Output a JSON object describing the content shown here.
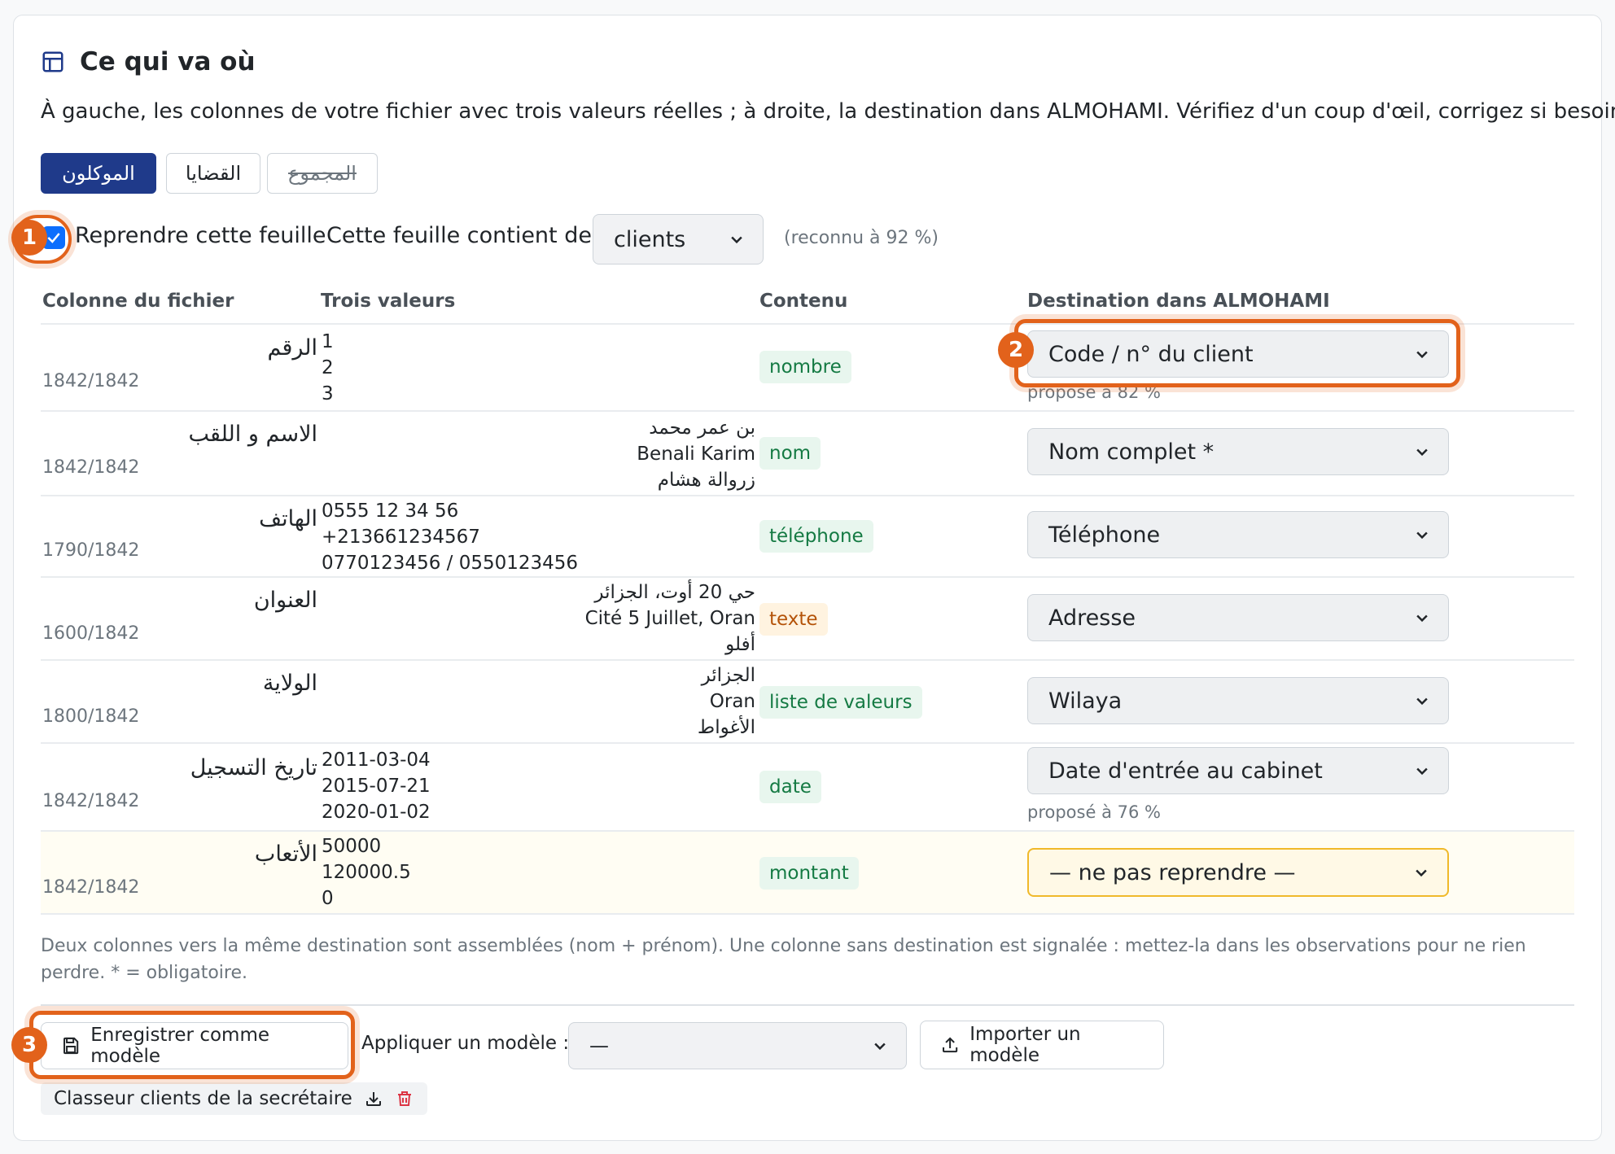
{
  "header": {
    "icon": "table-icon",
    "title": "Ce qui va où",
    "intro": "À gauche, les colonnes de votre fichier avec trois valeurs réelles ; à droite, la destination dans ALMOHAMI. Vérifiez d'un coup d'œil, corrigez si besoin."
  },
  "sheet_tabs": [
    {
      "label": "الموكلون",
      "active": true
    },
    {
      "label": "القضايا",
      "active": false
    },
    {
      "label": "المجموع",
      "active": false,
      "excluded": true
    }
  ],
  "sheet_options": {
    "take_sheet_label": "Reprendre cette feuille",
    "take_sheet_checked": true,
    "contains_label": "Cette feuille contient des",
    "contains_value": "clients",
    "recognized": "(reconnu à 92 %)"
  },
  "table": {
    "headers": [
      "Colonne du fichier",
      "Trois valeurs",
      "Contenu",
      "Destination dans ALMOHAMI"
    ],
    "rows": [
      {
        "column": "الرقم",
        "count": "1842/1842",
        "values": [
          "1",
          "2",
          "3"
        ],
        "content": "nombre",
        "destination": "Code / n° du client",
        "hint": "proposé à 82 %"
      },
      {
        "column": "الاسم و اللقب",
        "count": "1842/1842",
        "values": [
          "بن عمر محمد",
          "Benali Karim",
          "زروالة هشام"
        ],
        "content": "nom",
        "destination": "Nom complet *",
        "hint": ""
      },
      {
        "column": "الهاتف",
        "count": "1790/1842",
        "values": [
          "0555 12 34 56",
          "+213661234567",
          "0770123456 / 0550123456"
        ],
        "content": "téléphone",
        "destination": "Téléphone",
        "hint": ""
      },
      {
        "column": "العنوان",
        "count": "1600/1842",
        "values": [
          "حي 20 أوت، الجزائر",
          "Cité 5 Juillet, Oran",
          "أفلو"
        ],
        "content": "texte",
        "destination": "Adresse",
        "hint": ""
      },
      {
        "column": "الولاية",
        "count": "1800/1842",
        "values": [
          "الجزائر",
          "Oran",
          "الأغواط"
        ],
        "content": "liste de valeurs",
        "destination": "Wilaya",
        "hint": ""
      },
      {
        "column": "تاريخ التسجيل",
        "count": "1842/1842",
        "values": [
          "2011-03-04",
          "2015-07-21",
          "2020-01-02"
        ],
        "content": "date",
        "destination": "Date d'entrée au cabinet",
        "hint": "proposé à 76 %"
      },
      {
        "column": "الأتعاب",
        "count": "1842/1842",
        "values": [
          "50000",
          "120000.5",
          "0"
        ],
        "content": "montant",
        "destination": "— ne pas reprendre —",
        "hint": ""
      }
    ]
  },
  "footnote": "Deux colonnes vers la même destination sont assemblées (nom + prénom). Une colonne sans destination est signalée : mettez-la dans les observations pour ne rien perdre. * = obligatoire.",
  "footer": {
    "save_template": "Enregistrer comme modèle",
    "apply_label": "Appliquer un modèle :",
    "apply_value": "—",
    "import_template": "Importer un modèle",
    "saved_template": "Classeur clients de la secrétaire"
  },
  "annotations": [
    "1",
    "2",
    "3"
  ],
  "colors": {
    "accent": "#1f3a8a",
    "annotation": "#e2621b",
    "warning_border": "#f0b92a",
    "green_badge": "#147a43",
    "orange_badge": "#b45309",
    "danger": "#dc3545"
  }
}
